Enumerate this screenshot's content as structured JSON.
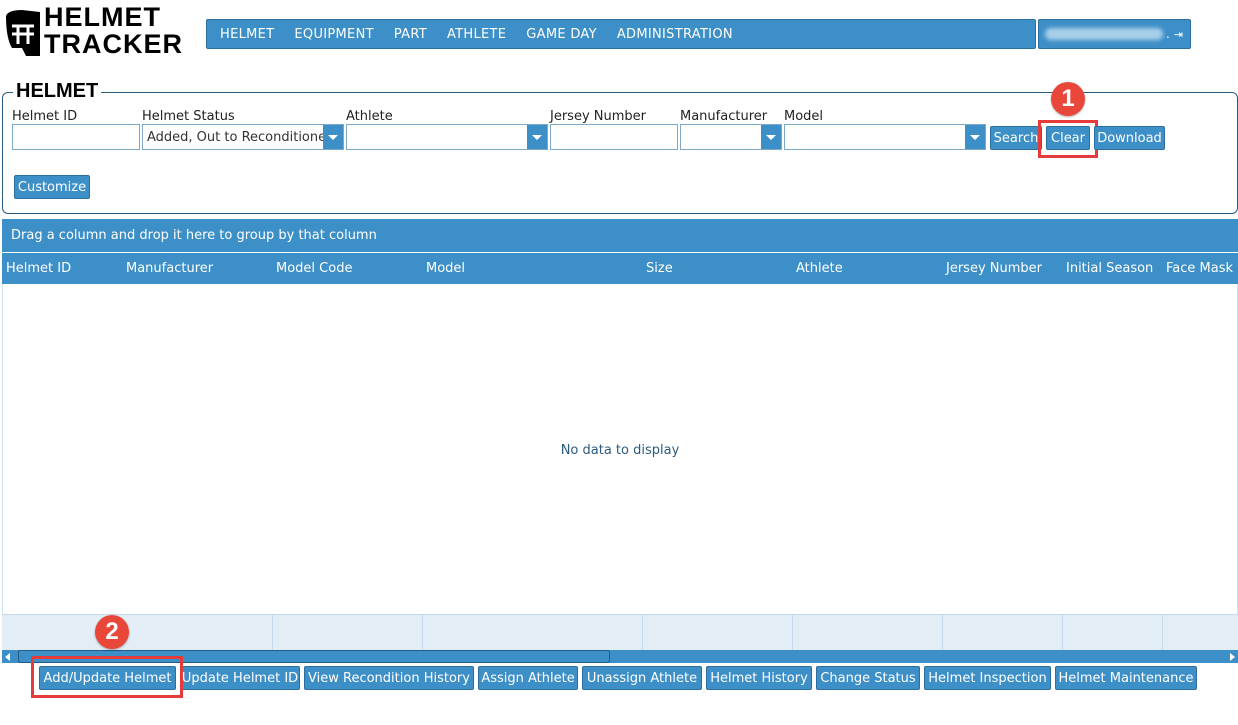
{
  "app": {
    "logo_line1": "HELMET",
    "logo_line2": "TRACKER"
  },
  "nav": {
    "items": [
      "HELMET",
      "EQUIPMENT",
      "PART",
      "ATHLETE",
      "GAME DAY",
      "ADMINISTRATION"
    ]
  },
  "user": {
    "suffix": ".",
    "logout_icon": "logout-icon"
  },
  "panel": {
    "title": "HELMET"
  },
  "filters": {
    "helmet_id": {
      "label": "Helmet ID",
      "value": ""
    },
    "helmet_status": {
      "label": "Helmet Status",
      "value": "Added, Out to Reconditione"
    },
    "athlete": {
      "label": "Athlete",
      "value": ""
    },
    "jersey_number": {
      "label": "Jersey Number",
      "value": ""
    },
    "manufacturer": {
      "label": "Manufacturer",
      "value": ""
    },
    "model": {
      "label": "Model",
      "value": ""
    }
  },
  "buttons": {
    "search": "Search",
    "clear": "Clear",
    "download": "Download",
    "customize": "Customize"
  },
  "grid": {
    "group_hint": "Drag a column and drop it here to group by that column",
    "columns": [
      "Helmet ID",
      "Manufacturer",
      "Model Code",
      "Model",
      "Size",
      "Athlete",
      "Jersey Number",
      "Initial Season",
      "Face Mask"
    ],
    "empty_text": "No data to display",
    "rows": []
  },
  "actions": [
    "Add/Update Helmet",
    "Update Helmet ID",
    "View Recondition History",
    "Assign Athlete",
    "Unassign Athlete",
    "Helmet History",
    "Change Status",
    "Helmet Inspection",
    "Helmet Maintenance"
  ],
  "callouts": [
    "1",
    "2"
  ],
  "colors": {
    "accent": "#3d8fc7",
    "callout": "#e8473a"
  }
}
